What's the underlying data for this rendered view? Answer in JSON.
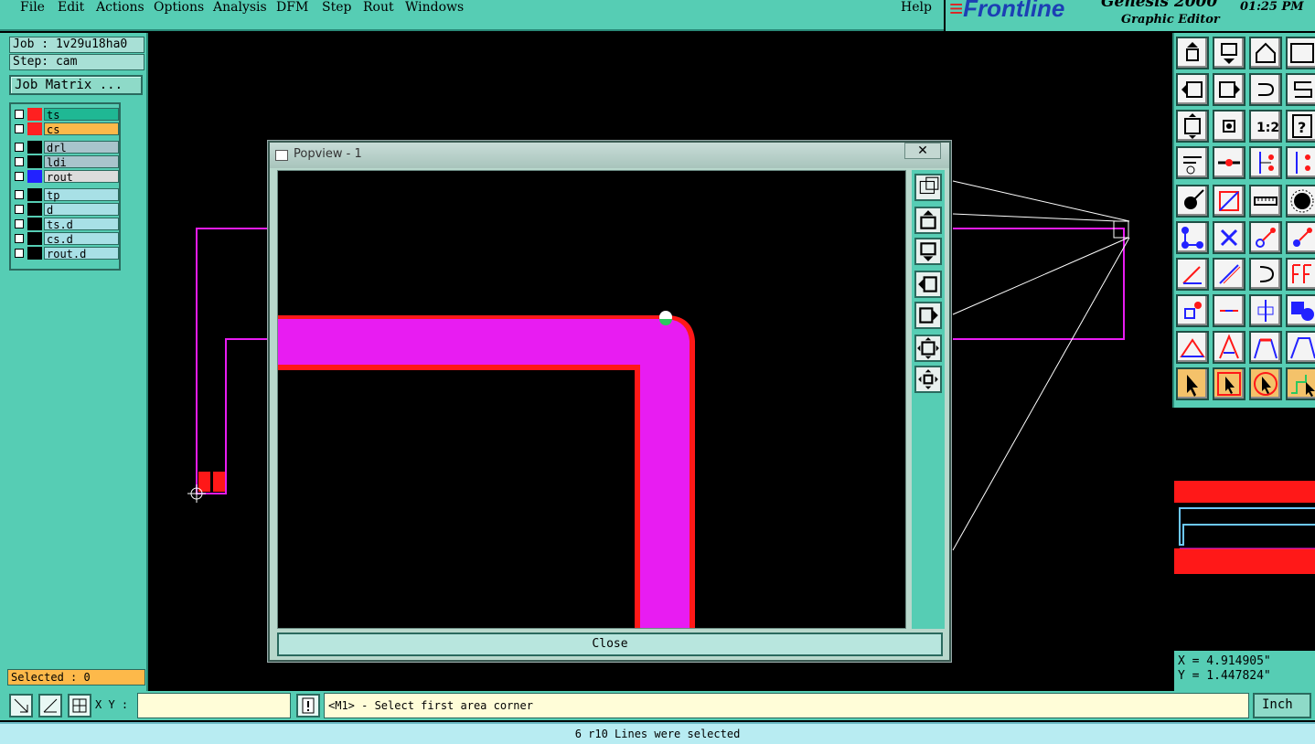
{
  "menu": {
    "items": [
      {
        "label": "File"
      },
      {
        "label": "Edit"
      },
      {
        "label": "Actions"
      },
      {
        "label": "Options"
      },
      {
        "label": "Analysis"
      },
      {
        "label": "DFM"
      },
      {
        "label": "Step"
      },
      {
        "label": "Rout"
      },
      {
        "label": "Windows"
      }
    ],
    "help": "Help"
  },
  "brand": {
    "logo": "Frontline",
    "product": "Genesis 2000",
    "subtitle": "Graphic Editor",
    "time": "01:25 PM"
  },
  "job": {
    "job_label": "Job : 1v29u18ha0",
    "step_label": "Step: cam",
    "matrix_button": "Job Matrix ..."
  },
  "layers": [
    {
      "name": "ts",
      "swatch": "#ff2020",
      "bg": "#1fb894"
    },
    {
      "name": "cs",
      "swatch": "#ff2020",
      "bg": "#fdb94a"
    },
    {
      "name": "drl",
      "swatch": "#000000",
      "bg": "#a8c4cc"
    },
    {
      "name": "ldi",
      "swatch": "#000000",
      "bg": "#a8c4cc"
    },
    {
      "name": "rout",
      "swatch": "#2222ff",
      "bg": "#dcdcdc"
    },
    {
      "name": "tp",
      "swatch": "#000000",
      "bg": "#a8e0e6"
    },
    {
      "name": "d",
      "swatch": "#000000",
      "bg": "#a8e0e6"
    },
    {
      "name": "ts.d",
      "swatch": "#000000",
      "bg": "#a8e0e6"
    },
    {
      "name": "cs.d",
      "swatch": "#000000",
      "bg": "#a8e0e6"
    },
    {
      "name": "rout.d",
      "swatch": "#000000",
      "bg": "#a8e0e6"
    }
  ],
  "selected": "Selected : 0",
  "coords": {
    "x": "X = 4.914905\"",
    "y": "Y = 1.447824\""
  },
  "command": {
    "xy_label": "X Y :",
    "xy_value": "",
    "prompt": "<M1> - Select first area corner",
    "unit": "Inch"
  },
  "status": "6 r10 Lines were selected",
  "popup": {
    "title": "Popview - 1",
    "close_label": "Close",
    "close_x": "✕"
  },
  "colors": {
    "panel": "#56cdb4",
    "trace_fill": "#e81cf2",
    "trace_outline": "#ff1818",
    "canvas": "#000000"
  },
  "icons": {
    "tools": [
      "zoom-home-icon",
      "zoom-previous-icon",
      "home-icon",
      "window-icon",
      "pan-left-icon",
      "pan-right-icon",
      "rotate-icon",
      "mirror-icon",
      "fit-icon",
      "center-icon",
      "scale-icon",
      "help-icon",
      "snap-icon",
      "measure-point-icon",
      "net-icon",
      "net-alt-icon",
      "pad-icon",
      "line-icon",
      "ruler-icon",
      "circle-icon",
      "connect-icon",
      "cross-icon",
      "move-icon",
      "move-alt-icon",
      "draw-line-icon",
      "draw-diag-icon",
      "arc-icon",
      "feature-icon",
      "pad-select-icon",
      "dash-icon",
      "bracket-icon",
      "shape-icon",
      "angle-icon",
      "peak-icon",
      "bridge-icon",
      "bridge-alt-icon",
      "select-icon",
      "select-box-icon",
      "select-circle-icon",
      "route-icon"
    ]
  }
}
